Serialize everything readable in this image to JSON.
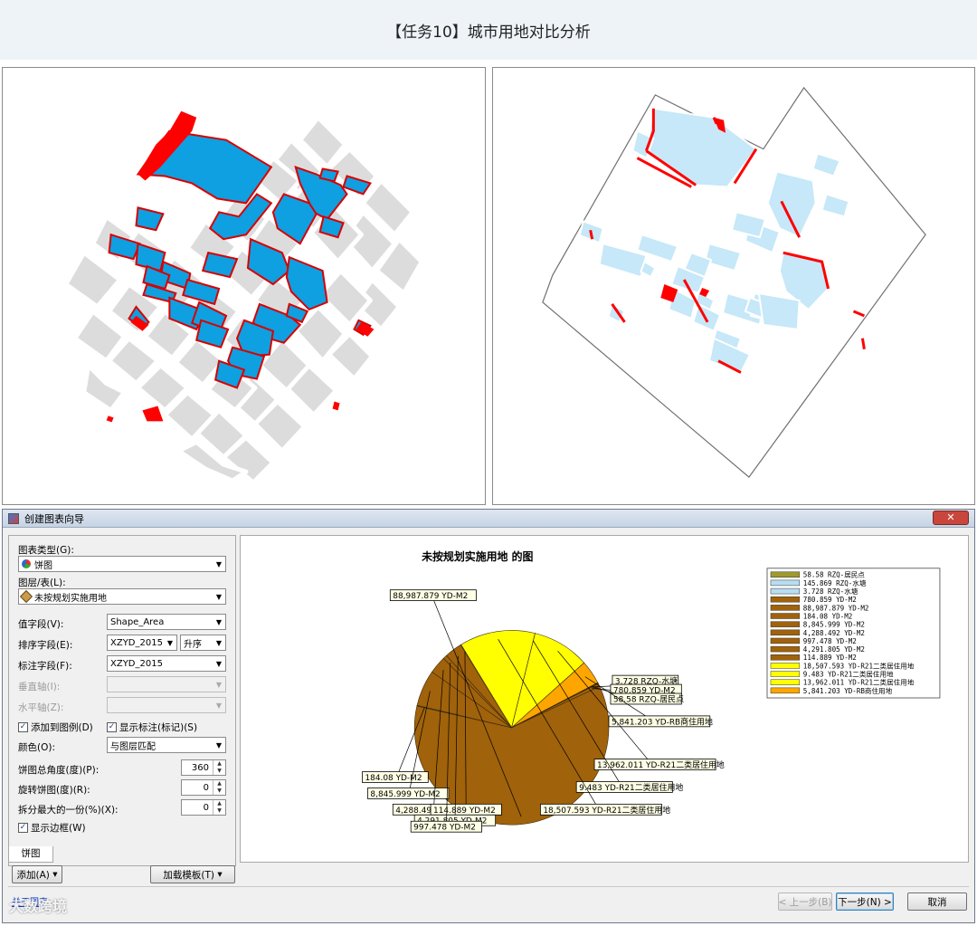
{
  "header": {
    "title": "【任务10】城市用地对比分析"
  },
  "dialog": {
    "title": "创建图表向导",
    "close_label": "✕",
    "fields": {
      "chart_type_label": "图表类型(G):",
      "chart_type_value": "饼图",
      "layer_label": "图层/表(L):",
      "layer_value": "未按规划实施用地",
      "value_field_label": "值字段(V):",
      "value_field_value": "Shape_Area",
      "sort_field_label": "排序字段(E):",
      "sort_field_value": "XZYD_2015",
      "sort_order_value": "升序",
      "label_field_label": "标注字段(F):",
      "label_field_value": "XZYD_2015",
      "vertical_axis_label": "垂直轴(I):",
      "horizontal_axis_label": "水平轴(Z):",
      "add_legend_label": "添加到图例(D)",
      "show_labels_label": "显示标注(标记)(S)",
      "color_label": "颜色(O):",
      "color_value": "与图层匹配",
      "total_angle_label": "饼图总角度(度)(P):",
      "total_angle_value": "360",
      "rotate_label": "旋转饼图(度)(R):",
      "rotate_value": "0",
      "explode_label": "拆分最大的一份(%)(X):",
      "explode_value": "0",
      "show_border_label": "显示边框(W)",
      "tab_label": "饼图",
      "add_button": "添加(A)",
      "load_template_button": "加载模板(T)",
      "about_link": "关于图表"
    },
    "buttons": {
      "prev": "< 上一步(B)",
      "next": "下一步(N) >",
      "cancel": "取消"
    }
  },
  "chart_data": {
    "type": "pie",
    "title": "未按规划实施用地  的图",
    "slices": [
      {
        "label": "58.58 RZQ-居民点",
        "value": 58.58,
        "color": "#a09a2c"
      },
      {
        "label": "145.869 RZQ-水塘",
        "value": 145.869,
        "color": "#b8def0"
      },
      {
        "label": "3.728 RZQ-水塘",
        "value": 3.728,
        "color": "#b8def0"
      },
      {
        "label": "780.859 YD-M2",
        "value": 780.859,
        "color": "#a0620a"
      },
      {
        "label": "88,987.879 YD-M2",
        "value": 88987.879,
        "color": "#a0620a"
      },
      {
        "label": "184.08 YD-M2",
        "value": 184.08,
        "color": "#a0620a"
      },
      {
        "label": "8,845.999 YD-M2",
        "value": 8845.999,
        "color": "#a0620a"
      },
      {
        "label": "4,288.492 YD-M2",
        "value": 4288.492,
        "color": "#a0620a"
      },
      {
        "label": "997.478 YD-M2",
        "value": 997.478,
        "color": "#a0620a"
      },
      {
        "label": "4,291.805 YD-M2",
        "value": 4291.805,
        "color": "#a0620a"
      },
      {
        "label": "114.889 YD-M2",
        "value": 114.889,
        "color": "#a0620a"
      },
      {
        "label": "18,507.593 YD-R21二类居住用地",
        "value": 18507.593,
        "color": "#ffff00"
      },
      {
        "label": "9.483 YD-R21二类居住用地",
        "value": 9.483,
        "color": "#ffff00"
      },
      {
        "label": "13,962.011 YD-R21二类居住用地",
        "value": 13962.011,
        "color": "#ffff00"
      },
      {
        "label": "5,841.203 YD-RB商住用地",
        "value": 5841.203,
        "color": "#ffa500"
      }
    ],
    "pie_order": [
      3,
      4,
      5,
      6,
      7,
      8,
      9,
      10,
      11,
      12,
      13,
      14,
      0,
      1,
      2
    ],
    "callouts": [
      "88,987.879 YD-M2",
      "3.728 RZQ-水塘",
      "780.859 YD-M2",
      "58.58 RZQ-居民点",
      "5,841.203 YD-RB商住用地",
      "13,962.011 YD-R21二类居住用地",
      "9.483 YD-R21二类居住用地",
      "18,507.593 YD-R21二类居住用地",
      "184.08 YD-M2",
      "8,845.999 YD-M2",
      "4,288.492 YD-M2",
      "114.889 YD-M2",
      "4,291.805 YD-M2",
      "997.478 YD-M2"
    ],
    "legend_position": "top-right"
  },
  "watermark": "大数跨境",
  "colors": {
    "land_blue": "#0ea0e0",
    "land_grey": "#dcdcdc",
    "land_red": "#ff0000",
    "land_light_blue": "#c6e8f8"
  }
}
